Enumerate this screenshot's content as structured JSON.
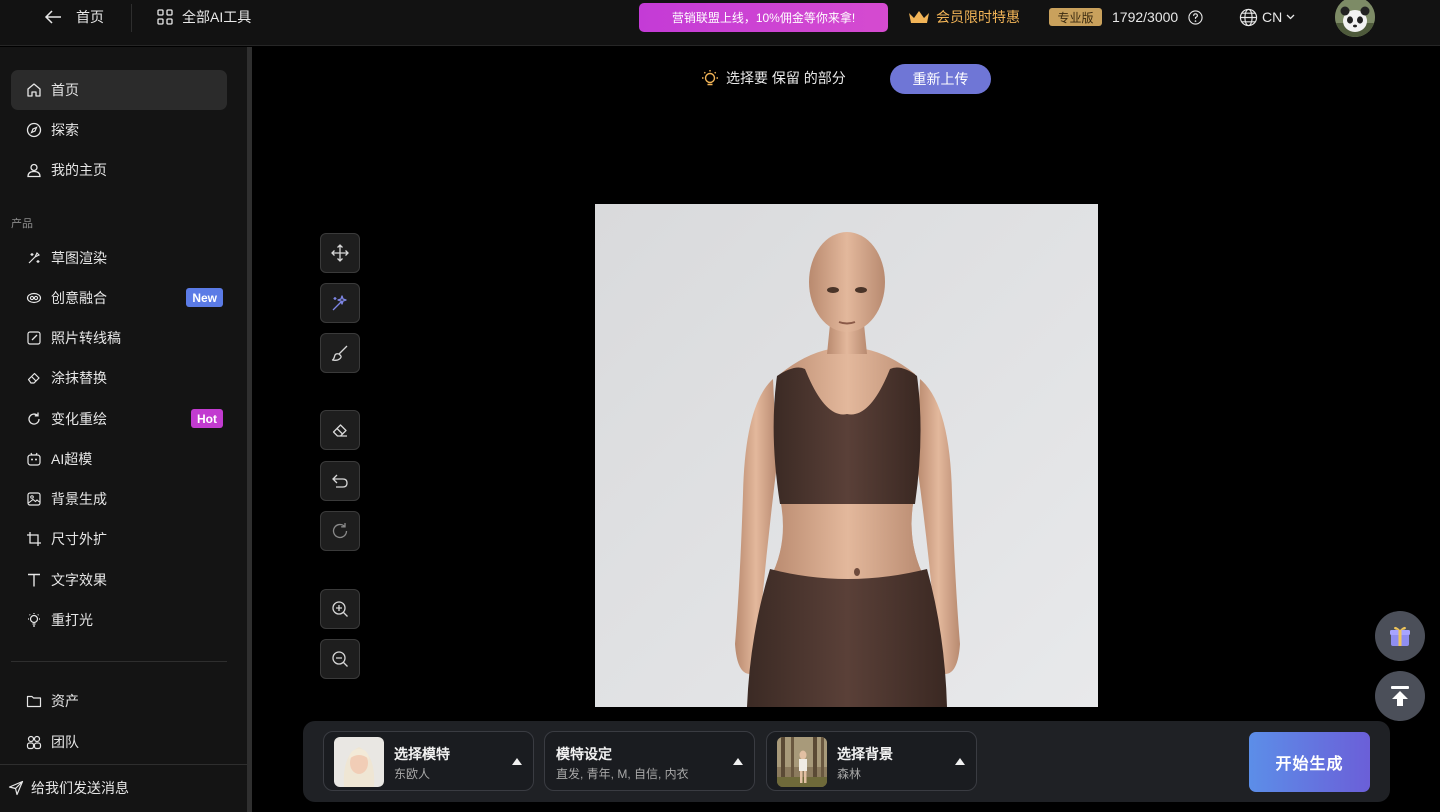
{
  "topbar": {
    "back_label": "首页",
    "all_tools_label": "全部AI工具",
    "promo_text": "营销联盟上线，10%佣金等你来拿!",
    "vip_text": "会员限时特惠",
    "plan_badge": "专业版",
    "credits": "1792/3000",
    "language": "CN"
  },
  "sidebar": {
    "top_items": [
      {
        "label": "首页",
        "icon": "home-icon"
      },
      {
        "label": "探索",
        "icon": "compass-icon"
      },
      {
        "label": "我的主页",
        "icon": "user-icon"
      }
    ],
    "section_label": "产品",
    "product_items": [
      {
        "label": "草图渲染",
        "icon": "sketch-icon"
      },
      {
        "label": "创意融合",
        "icon": "blend-icon",
        "badge": "New"
      },
      {
        "label": "照片转线稿",
        "icon": "edit-icon"
      },
      {
        "label": "涂抹替换",
        "icon": "eraser-icon"
      },
      {
        "label": "变化重绘",
        "icon": "refresh-icon",
        "badge": "Hot"
      },
      {
        "label": "AI超模",
        "icon": "robot-icon"
      },
      {
        "label": "背景生成",
        "icon": "image-icon"
      },
      {
        "label": "尺寸外扩",
        "icon": "crop-icon"
      },
      {
        "label": "文字效果",
        "icon": "text-icon"
      },
      {
        "label": "重打光",
        "icon": "bulb-icon"
      }
    ],
    "bottom_items": [
      {
        "label": "资产",
        "icon": "folder-icon"
      },
      {
        "label": "团队",
        "icon": "team-icon"
      }
    ],
    "feedback_label": "给我们发送消息"
  },
  "main": {
    "hint_text": "选择要 保留 的部分",
    "reupload_label": "重新上传",
    "tools": [
      "move-icon",
      "magic-wand-icon",
      "brush-icon",
      "eraser-icon",
      "undo-icon",
      "reset-icon",
      "zoom-in-icon",
      "zoom-out-icon"
    ]
  },
  "bottom_panel": {
    "model": {
      "title": "选择模特",
      "subtitle": "东欧人"
    },
    "settings": {
      "title": "模特设定",
      "subtitle": "直发, 青年, M, 自信, 内衣"
    },
    "background": {
      "title": "选择背景",
      "subtitle": "森林"
    },
    "generate_label": "开始生成"
  },
  "colors": {
    "promo": "#c43bd6",
    "accent": "#6f76d6",
    "vip_gold": "#f2b457",
    "new_badge": "#5b7be6",
    "hot_badge": "#c23bd0"
  }
}
